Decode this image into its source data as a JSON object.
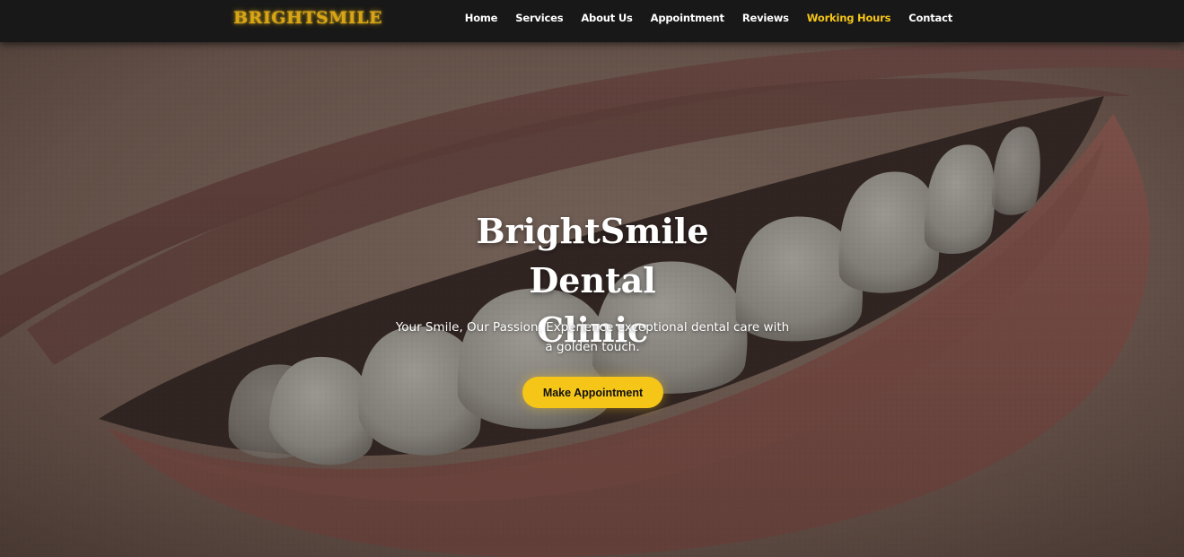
{
  "brand": {
    "logo_text": "BRIGHTSMILE"
  },
  "nav": {
    "items": [
      {
        "label": "Home",
        "active": false
      },
      {
        "label": "Services",
        "active": false
      },
      {
        "label": "About Us",
        "active": false
      },
      {
        "label": "Appointment",
        "active": false
      },
      {
        "label": "Reviews",
        "active": false
      },
      {
        "label": "Working Hours",
        "active": true
      },
      {
        "label": "Contact",
        "active": false
      }
    ]
  },
  "hero": {
    "title_line1": "BrightSmile Dental",
    "title_line2": "Clinic",
    "subtitle_line1": "Your Smile, Our Passion. Experience exceptional dental care with",
    "subtitle_line2": "a golden touch.",
    "cta_label": "Make Appointment",
    "background_image": "close-up of smiling lips with white teeth"
  },
  "colors": {
    "accent": "#f5c518",
    "logo": "#d9a514",
    "nav_bg": "#181818",
    "nav_text": "#ffffff",
    "hero_text": "#ffffff",
    "button_text": "#111111"
  }
}
